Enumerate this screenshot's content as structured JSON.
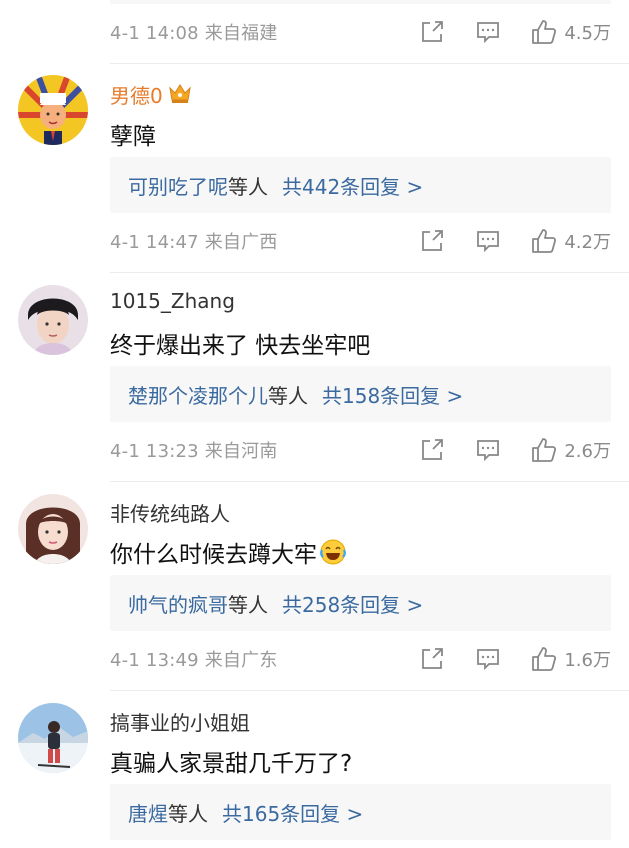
{
  "top_meta": {
    "time": "4-1 14:08",
    "location": "来自福建",
    "likes": "4.5万"
  },
  "comments": [
    {
      "username": "男德0",
      "text": "孽障",
      "reply": {
        "replier": "可别吃了呢",
        "etc": "等人",
        "total": "共442条回复 >"
      },
      "time": "4-1 14:47",
      "location": "来自广西",
      "likes": "4.2万"
    },
    {
      "username": "1015_Zhang",
      "text": "终于爆出来了 快去坐牢吧",
      "reply": {
        "replier": "楚那个凌那个儿",
        "etc": "等人",
        "total": "共158条回复 >"
      },
      "time": "4-1 13:23",
      "location": "来自河南",
      "likes": "2.6万"
    },
    {
      "username": "非传统纯路人",
      "text": "你什么时候去蹲大牢",
      "reply": {
        "replier": "帅气的疯哥",
        "etc": "等人",
        "total": "共258条回复 >"
      },
      "time": "4-1 13:49",
      "location": "来自广东",
      "likes": "1.6万"
    },
    {
      "username": "搞事业的小姐姐",
      "text": "真骗人家景甜几千万了?",
      "reply": {
        "replier": "唐煋",
        "etc": "等人",
        "total": "共165条回复 >"
      }
    }
  ],
  "icons": {
    "share": "share-icon",
    "comment": "comment-icon",
    "like": "thumbs-up-icon",
    "vip": "crown-badge-icon",
    "emoji": "laugh-cry-emoji-icon"
  },
  "colors": {
    "vip_name": "#e77c2d",
    "link": "#3b6aa0",
    "meta_gray": "#9a9a9a",
    "reply_bg": "#f7f7f7"
  }
}
